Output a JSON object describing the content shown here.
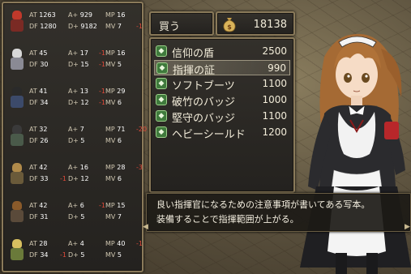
{
  "shop": {
    "title": "買う",
    "gold": "18138",
    "items": [
      {
        "name": "信仰の盾",
        "price": "2500"
      },
      {
        "name": "指揮の証",
        "price": "990"
      },
      {
        "name": "ソフトブーツ",
        "price": "1100"
      },
      {
        "name": "破竹のバッジ",
        "price": "1000"
      },
      {
        "name": "堅守のバッジ",
        "price": "1100"
      },
      {
        "name": "ヘビーシールド",
        "price": "1200"
      }
    ],
    "selected_index": 1,
    "description_line1": "良い指揮官になるための注意事項が書いてある写本。",
    "description_line2": "装備することで指揮範囲が上がる。"
  },
  "units": [
    {
      "hair": "#c0392b",
      "armor": "#7a2a24",
      "at": "1263",
      "at_mod": "",
      "a_plus": "929",
      "a_mod": "",
      "mp": "16",
      "mp_mod": "",
      "df": "1280",
      "df_mod": "",
      "d_plus": "9182",
      "d_mod": "",
      "mv": "7",
      "mv_mod": "-1"
    },
    {
      "hair": "#d8d8d8",
      "armor": "#8a8a94",
      "at": "45",
      "at_mod": "",
      "a_plus": "17",
      "a_mod": "-1",
      "mp": "16",
      "mp_mod": "",
      "df": "30",
      "df_mod": "",
      "d_plus": "15",
      "d_mod": "-1",
      "mv": "5",
      "mv_mod": ""
    },
    {
      "hair": "#2a2a2a",
      "armor": "#3c4a6a",
      "at": "41",
      "at_mod": "",
      "a_plus": "13",
      "a_mod": "-1",
      "mp": "29",
      "mp_mod": "",
      "df": "34",
      "df_mod": "",
      "d_plus": "12",
      "d_mod": "-1",
      "mv": "6",
      "mv_mod": ""
    },
    {
      "hair": "#3a3a3a",
      "armor": "#4a5a4a",
      "at": "32",
      "at_mod": "",
      "a_plus": "7",
      "a_mod": "",
      "mp": "71",
      "mp_mod": "-20",
      "df": "26",
      "df_mod": "",
      "d_plus": "5",
      "d_mod": "",
      "mv": "6",
      "mv_mod": ""
    },
    {
      "hair": "#b08a4a",
      "armor": "#6a5a3a",
      "at": "42",
      "at_mod": "",
      "a_plus": "16",
      "a_mod": "",
      "mp": "28",
      "mp_mod": "-3",
      "df": "33",
      "df_mod": "-1",
      "d_plus": "12",
      "d_mod": "",
      "mv": "6",
      "mv_mod": ""
    },
    {
      "hair": "#8a5a2a",
      "armor": "#5a4a3a",
      "at": "42",
      "at_mod": "",
      "a_plus": "6",
      "a_mod": "-1",
      "mp": "15",
      "mp_mod": "",
      "df": "31",
      "df_mod": "",
      "d_plus": "5",
      "d_mod": "",
      "mv": "7",
      "mv_mod": ""
    },
    {
      "hair": "#d8c060",
      "armor": "#6a7a3a",
      "at": "28",
      "at_mod": "",
      "a_plus": "4",
      "a_mod": "",
      "mp": "40",
      "mp_mod": "-1",
      "df": "34",
      "df_mod": "-1",
      "d_plus": "5",
      "d_mod": "",
      "mv": "5",
      "mv_mod": ""
    }
  ],
  "labels": {
    "at": "AT",
    "a_plus": "A+",
    "mp": "MP",
    "df": "DF",
    "d_plus": "D+",
    "mv": "MV"
  },
  "colors": {
    "panel_border": "#8a7a5a",
    "text": "#f2ecd9",
    "stat_down": "#e24a3a",
    "stat_up": "#8fbf6a",
    "selection": "#c8be9f"
  }
}
